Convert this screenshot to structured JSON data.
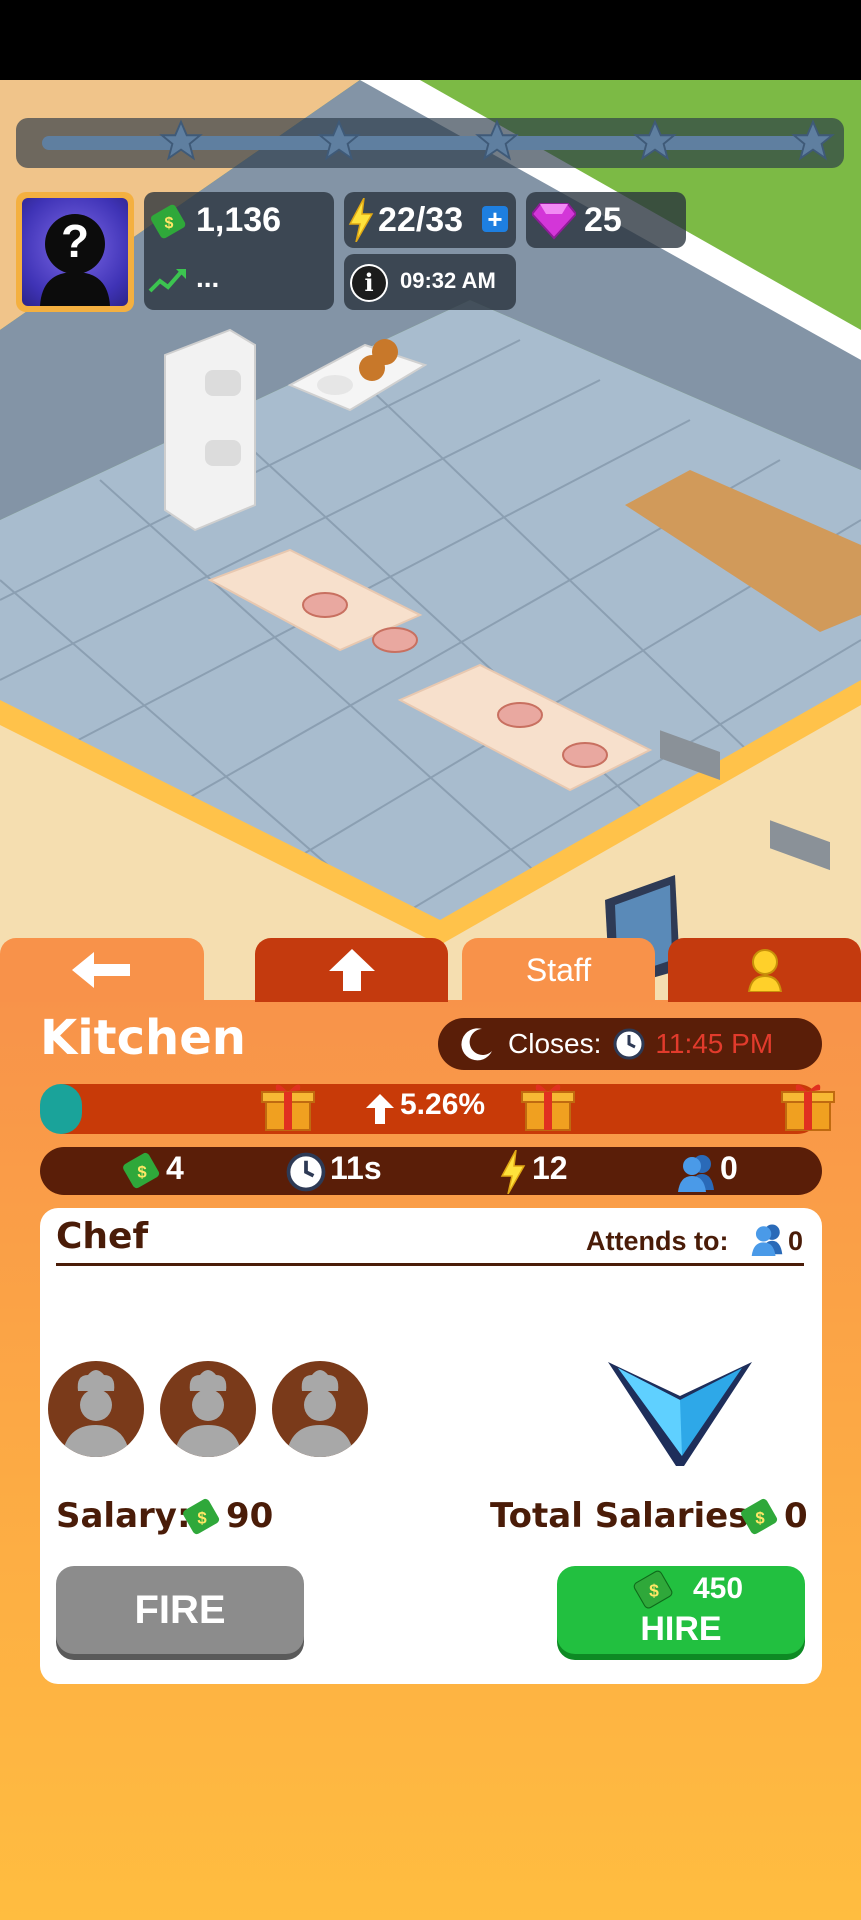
{
  "hud": {
    "money": "1,136",
    "income": "...",
    "energy": "22/33",
    "gems": "25",
    "time": "09:32 AM",
    "avatar_glyph": "?"
  },
  "tabs": {
    "staff": "Staff"
  },
  "panel": {
    "title": "Kitchen",
    "closes_label": "Closes:",
    "closes_time": "11:45 PM",
    "closes_time_color": "#e23b2c",
    "level_progress": "5.26%",
    "level_fill_fraction": 0.02,
    "stats": {
      "money": "4",
      "time": "11s",
      "energy": "12",
      "people": "0"
    }
  },
  "card": {
    "role": "Chef",
    "attends_label": "Attends to:",
    "attends_value": "0",
    "slots_filled": 0,
    "slots_total": 3,
    "salary_label": "Salary:",
    "salary_value": "90",
    "total_label": "Total Salaries:",
    "total_value": "0",
    "fire_label": "FIRE",
    "hire_cost": "450",
    "hire_label": "HIRE"
  },
  "colors": {
    "panel": "#f8924a",
    "tab_dark": "#c43a0e",
    "pill_dark": "#5a1e08",
    "hire": "#22c040",
    "fire": "#8c8c8c",
    "teal_fill": "#1aa39a"
  },
  "icons": [
    "back-arrow-icon",
    "up-arrow-icon",
    "person-icon",
    "moon-icon",
    "clock-icon",
    "gift-icon",
    "cash-icon",
    "lightning-icon",
    "gem-icon",
    "plus-icon",
    "info-icon",
    "trend-icon",
    "star-icon",
    "chef-silhouette-icon",
    "down-arrow-icon"
  ]
}
